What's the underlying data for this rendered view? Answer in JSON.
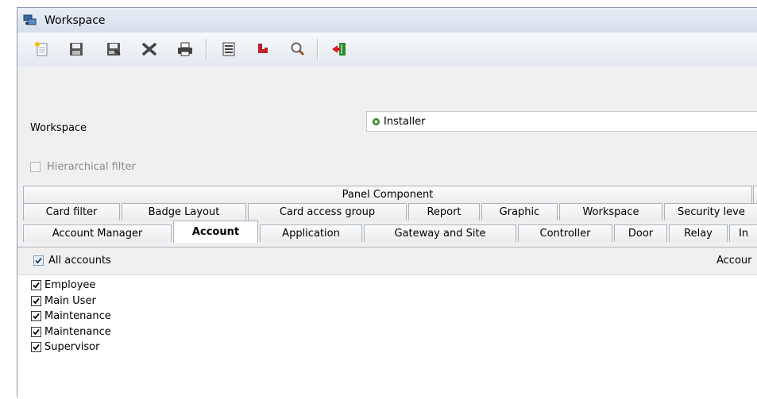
{
  "window": {
    "title": "Workspace"
  },
  "toolbar": {
    "buttons": [
      {
        "icon": "new-icon"
      },
      {
        "icon": "save-icon"
      },
      {
        "icon": "save-as-icon"
      },
      {
        "icon": "delete-icon"
      },
      {
        "icon": "print-icon"
      },
      {
        "icon": "list-icon"
      },
      {
        "icon": "link-icon"
      },
      {
        "icon": "search-icon"
      },
      {
        "icon": "exit-icon"
      }
    ]
  },
  "form": {
    "workspace_label": "Workspace",
    "workspace_value": "Installer",
    "hierarchical_filter_label": "Hierarchical filter"
  },
  "tabs": {
    "row1": [
      "Panel Component"
    ],
    "row2": [
      "Card filter",
      "Badge Layout",
      "Card access group",
      "Report",
      "Graphic",
      "Workspace",
      "Security leve"
    ],
    "row3": [
      "Account Manager",
      "Account",
      "Application",
      "Gateway and Site",
      "Controller",
      "Door",
      "Relay",
      "In"
    ],
    "active": "Account"
  },
  "account_tab": {
    "all_accounts_label": "All accounts",
    "right_label": "Accour",
    "items": [
      "Employee",
      "Main User",
      "Maintenance",
      "Maintenance",
      "Supervisor"
    ]
  },
  "colors": {
    "accent_green": "#2e8b2e",
    "toolbar_gradient_top": "#f6f8fb"
  }
}
